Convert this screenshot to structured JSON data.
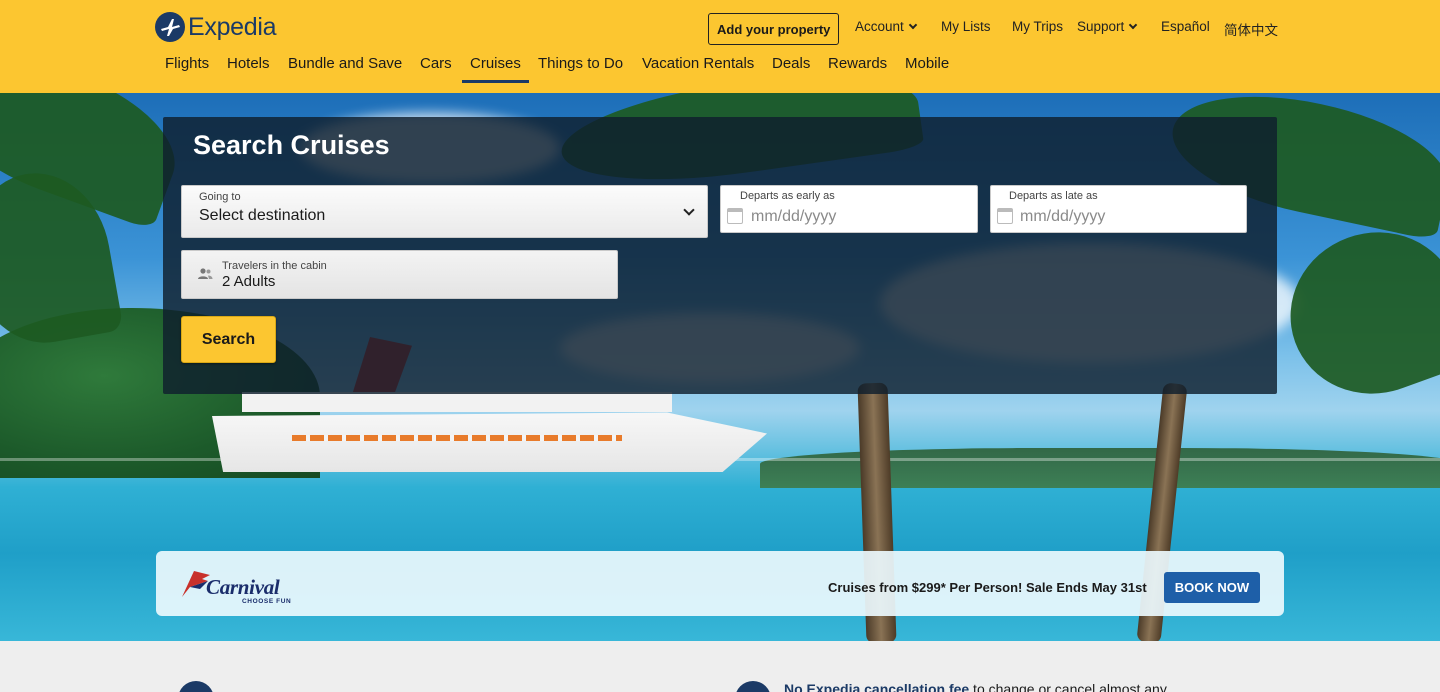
{
  "header": {
    "logo_text": "Expedia",
    "add_property_label": "Add your property",
    "top_links": {
      "account": "Account",
      "my_lists": "My Lists",
      "my_trips": "My Trips",
      "support": "Support",
      "espanol": "Español",
      "chinese": "简体中文"
    },
    "nav": [
      "Flights",
      "Hotels",
      "Bundle and Save",
      "Cars",
      "Cruises",
      "Things to Do",
      "Vacation Rentals",
      "Deals",
      "Rewards",
      "Mobile"
    ],
    "active_nav": "Cruises"
  },
  "search": {
    "title": "Search Cruises",
    "going_to_label": "Going to",
    "going_to_value": "Select destination",
    "depart_early_label": "Departs as early as",
    "depart_early_placeholder": "mm/dd/yyyy",
    "depart_late_label": "Departs as late as",
    "depart_late_placeholder": "mm/dd/yyyy",
    "travelers_label": "Travelers in the cabin",
    "travelers_value": "2 Adults",
    "search_button": "Search"
  },
  "promo": {
    "brand": "Carnival",
    "brand_tagline": "CHOOSE FUN",
    "text": "Cruises from $299* Per Person! Sale Ends May 31st",
    "button": "BOOK NOW"
  },
  "bottom": {
    "right_bold": "No Expedia cancellation fee",
    "right_rest": " to change or cancel almost any"
  },
  "colors": {
    "header_bg": "#fcc630",
    "brand_blue": "#1b3a66",
    "book_button": "#1e5fa8"
  },
  "icons": [
    "expedia-plane-icon",
    "chevron-down-icon",
    "calendar-icon",
    "people-icon"
  ]
}
